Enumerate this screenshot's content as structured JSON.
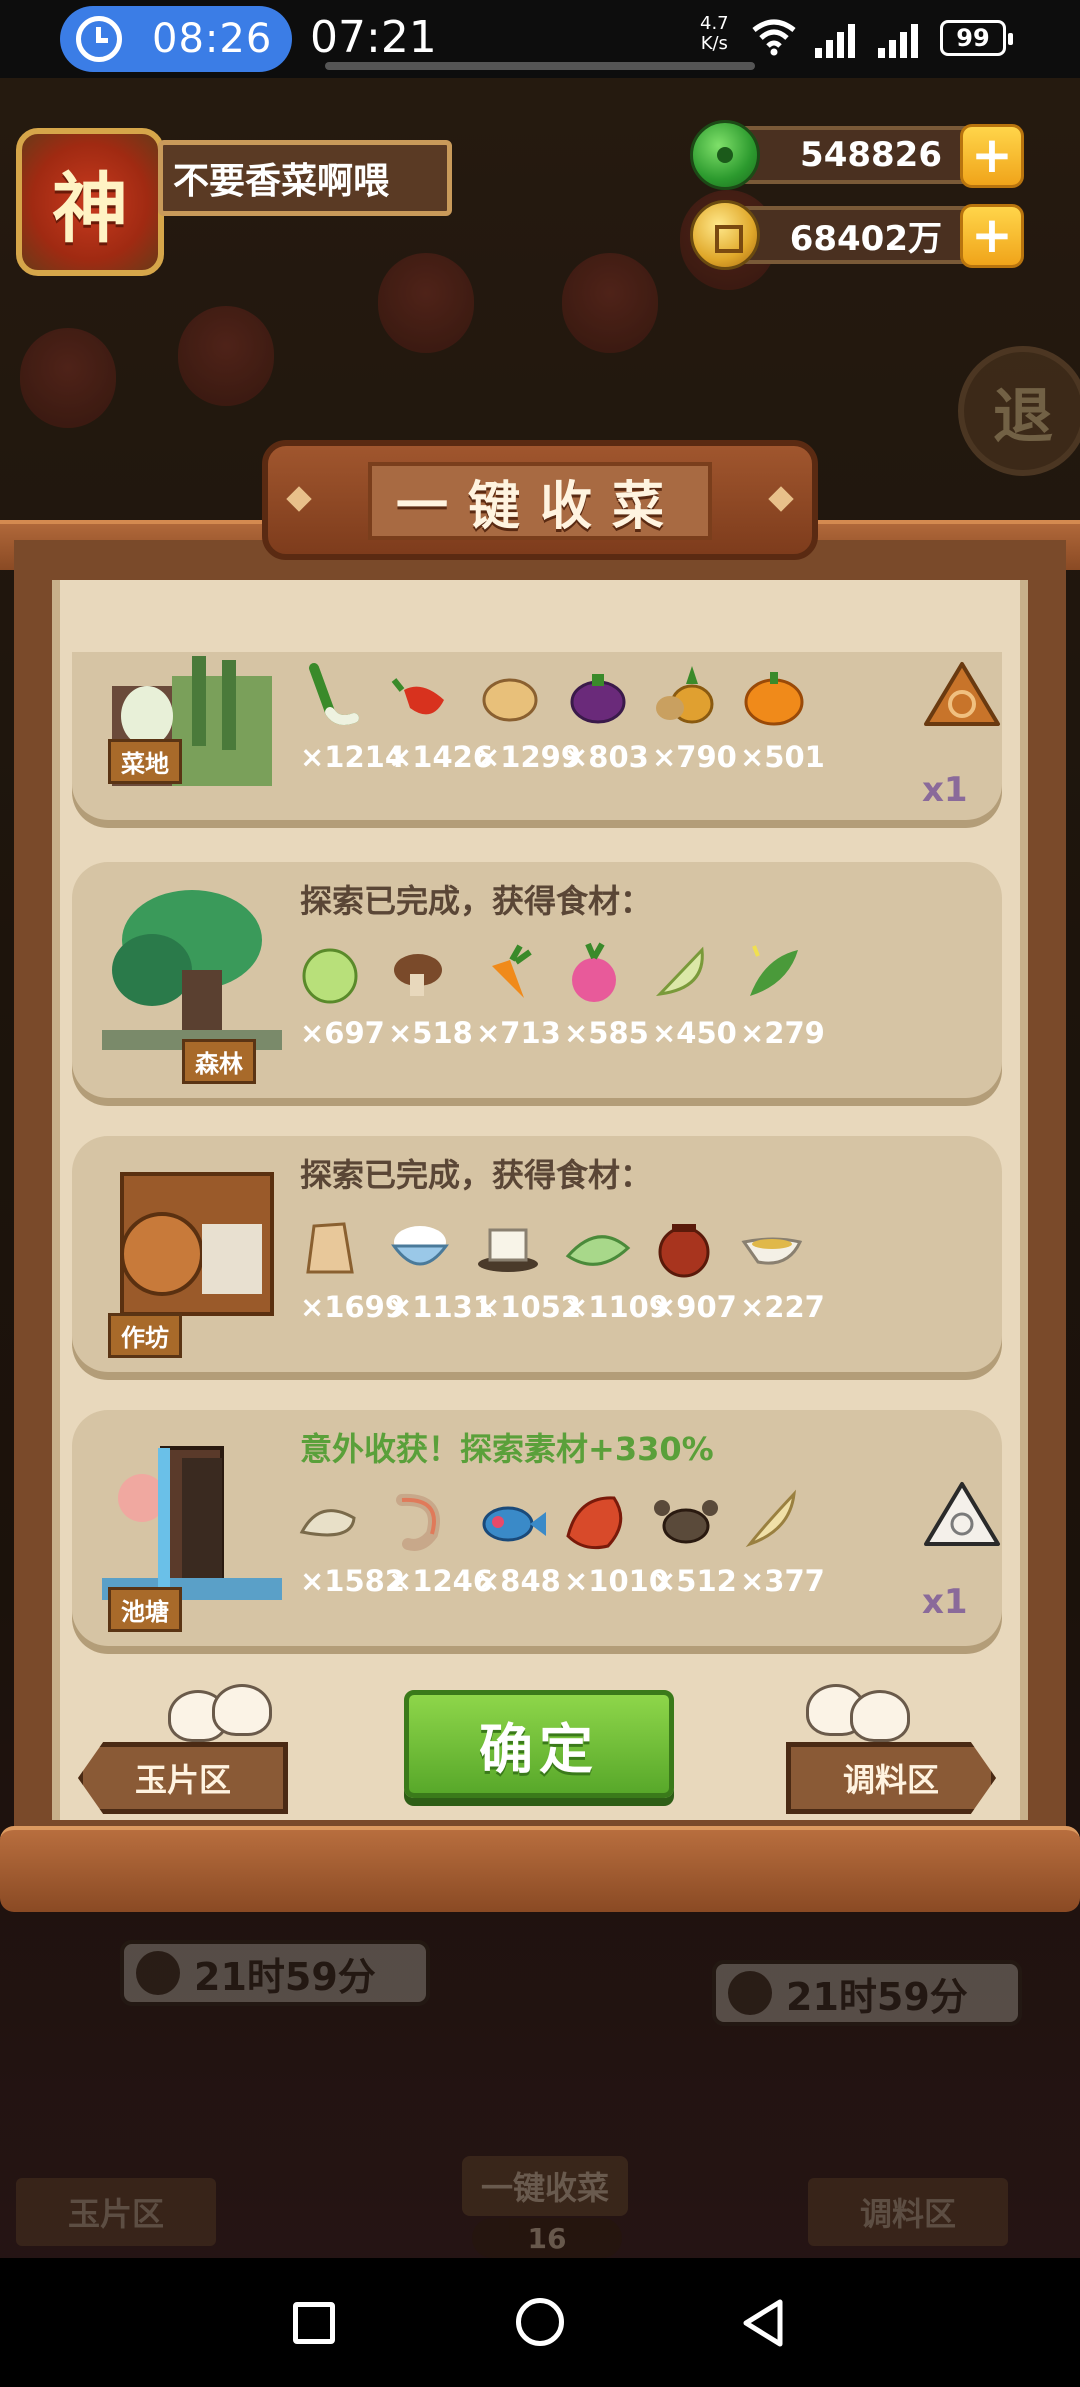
{
  "status_bar": {
    "alarm_time": "08:26",
    "time": "07:21",
    "net_speed_value": "4.7",
    "net_speed_unit": "K/s",
    "battery": "99"
  },
  "player": {
    "avatar_glyph": "神",
    "name": "不要香菜啊喂"
  },
  "currency": {
    "jade": "548826",
    "coins": "68402万"
  },
  "background": {
    "exit_glyph": "退"
  },
  "dialog": {
    "title": "一键收菜",
    "rows": [
      {
        "id": "field",
        "tag": "菜地",
        "message": "",
        "items": [
          {
            "icon": "scallion-icon",
            "count": "×1214"
          },
          {
            "icon": "chili-pepper-icon",
            "count": "×1426"
          },
          {
            "icon": "potato-icon",
            "count": "×1299"
          },
          {
            "icon": "eggplant-icon",
            "count": "×803"
          },
          {
            "icon": "pineapple-icon",
            "count": "×790"
          },
          {
            "icon": "pumpkin-icon",
            "count": "×501"
          }
        ],
        "badge_icon": "orange-triangle-token-icon",
        "multiplier": "x1"
      },
      {
        "id": "forest",
        "tag": "森林",
        "message": "探索已完成，获得食材：",
        "items": [
          {
            "icon": "cabbage-icon",
            "count": "×697"
          },
          {
            "icon": "mushroom-icon",
            "count": "×518"
          },
          {
            "icon": "carrot-icon",
            "count": "×713"
          },
          {
            "icon": "radish-icon",
            "count": "×585"
          },
          {
            "icon": "bamboo-shoot-icon",
            "count": "×450"
          },
          {
            "icon": "herb-leaf-icon",
            "count": "×279"
          }
        ]
      },
      {
        "id": "workshop",
        "tag": "作坊",
        "message": "探索已完成，获得食材：",
        "items": [
          {
            "icon": "flour-sack-icon",
            "count": "×1699"
          },
          {
            "icon": "rice-bowl-icon",
            "count": "×1131"
          },
          {
            "icon": "tofu-icon",
            "count": "×1052"
          },
          {
            "icon": "rice-dumpling-icon",
            "count": "×1109"
          },
          {
            "icon": "sauce-jar-icon",
            "count": "×907"
          },
          {
            "icon": "gravy-boat-icon",
            "count": "×227"
          }
        ]
      },
      {
        "id": "pond",
        "tag": "池塘",
        "message": "意外收获！探索素材+330%",
        "items": [
          {
            "icon": "clam-icon",
            "count": "×1582"
          },
          {
            "icon": "shrimp-icon",
            "count": "×1246"
          },
          {
            "icon": "fish-icon",
            "count": "×848"
          },
          {
            "icon": "meat-icon",
            "count": "×1010"
          },
          {
            "icon": "crab-icon",
            "count": "×512"
          },
          {
            "icon": "fish-fin-icon",
            "count": "×377"
          }
        ],
        "badge_icon": "white-triangle-token-icon",
        "multiplier": "x1"
      }
    ],
    "left_button": "玉片区",
    "confirm_button": "确定",
    "right_button": "调料区"
  },
  "background_ui": {
    "timer_left": "21时59分",
    "timer_right": "21时59分",
    "left_button": "玉片区",
    "harvest_button": "一键收菜",
    "harvest_count": "16",
    "right_button": "调料区"
  },
  "colors": {
    "panel_bg": "#e8d8bc",
    "row_bg": "#d6c4a4",
    "confirm_green": "#58a82a",
    "highlight_green": "#5aa03a",
    "alarm_blue": "#3b7de6"
  }
}
